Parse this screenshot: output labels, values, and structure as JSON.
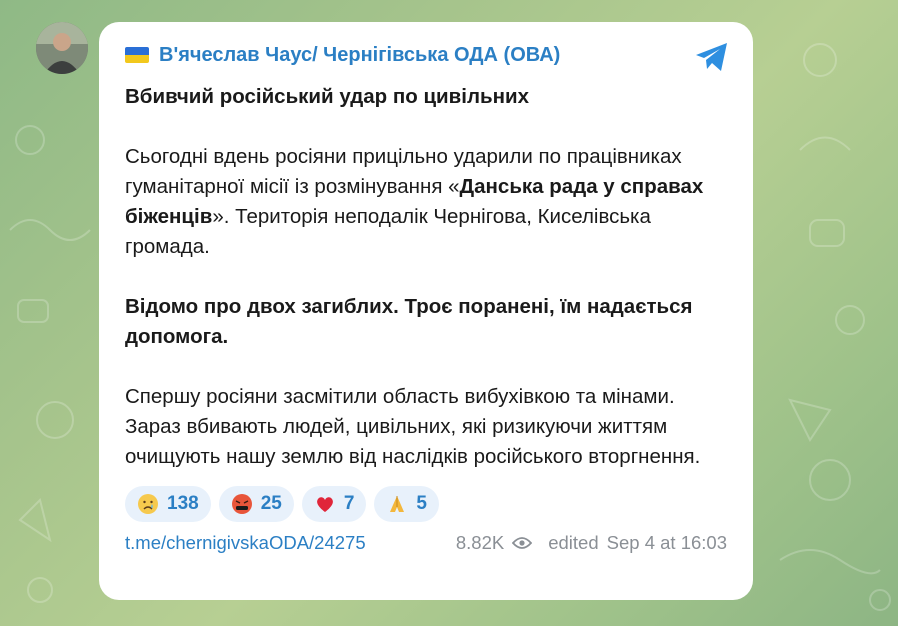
{
  "channel": {
    "name": "В'ячеслав Чаус/ Чернігівська ОДА (ОВА)",
    "flag_colors": [
      "#2a6fd6",
      "#f2c81d"
    ]
  },
  "post": {
    "title": "Вбивчий російський удар по цивільних",
    "p1_a": "Сьогодні вдень росіяни прицільно ударили по працівниках гуманітарної місії із розмінування «",
    "p1_bold": "Данська рада у справах біженців",
    "p1_b": "». Територія неподалік Чернігова, Киселівська громада.",
    "p2": "Відомо про двох загиблих. Троє поранені, їм надається допомога.",
    "p3": "Спершу росіяни засмітили область вибухівкою та мінами. Зараз вбивають людей, цивільних, які ризикуючи життям очищують нашу землю від наслідків російського вторгнення."
  },
  "reactions": [
    {
      "icon": "crying-face-icon",
      "count": "138"
    },
    {
      "icon": "swearing-face-icon",
      "count": "25"
    },
    {
      "icon": "red-heart-icon",
      "count": "7"
    },
    {
      "icon": "praying-hands-icon",
      "count": "5"
    }
  ],
  "footer": {
    "link": "t.me/chernigivskaODA/24275",
    "views": "8.82K",
    "edited": "edited",
    "timestamp": "Sep 4 at 16:03"
  },
  "colors": {
    "accent": "#2b7fc4",
    "reaction_bg": "#e8f1fb",
    "meta": "#8a8f95"
  }
}
